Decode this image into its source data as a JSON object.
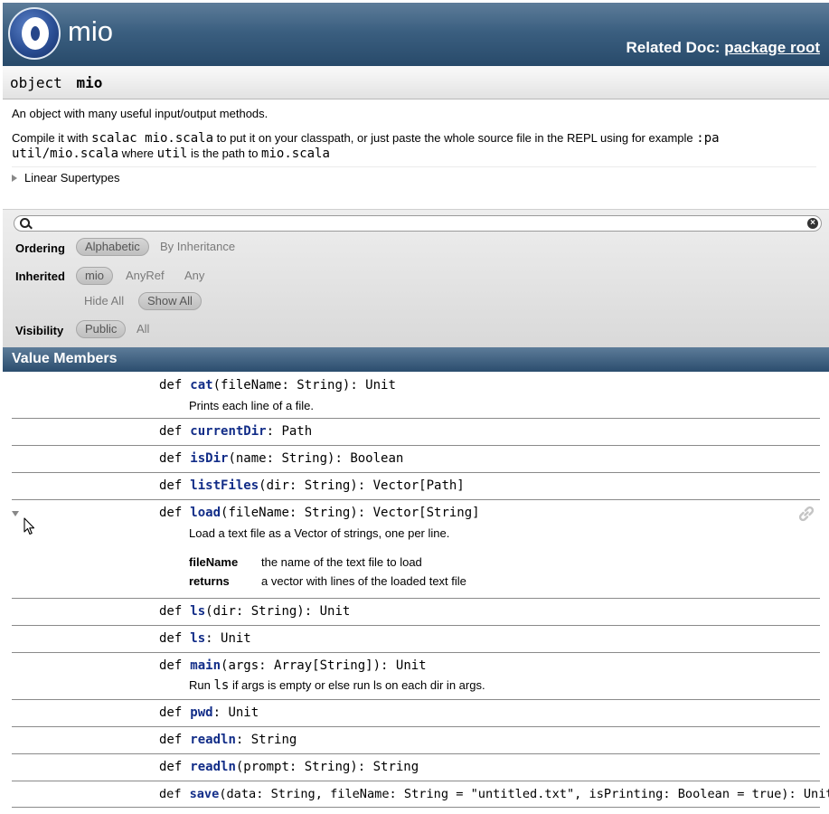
{
  "header": {
    "title": "mio",
    "related_label": "Related Doc:",
    "related_link": "package root"
  },
  "object": {
    "keyword": "object",
    "name": "mio"
  },
  "comment": {
    "line1": "An object with many useful input/output methods.",
    "line2_a": "Compile it with ",
    "line2_code1": "scalac mio.scala",
    "line2_b": " to put it on your classpath, or just paste the whole source file in the REPL using for example ",
    "line2_code2": ":pa",
    "line3_code1": "util/mio.scala",
    "line3_a": " where ",
    "line3_code2": "util",
    "line3_b": " is the path to ",
    "line3_code3": "mio.scala"
  },
  "supertypes_label": "Linear Supertypes",
  "filter": {
    "search_value": "",
    "ordering_label": "Ordering",
    "ordering_options": [
      "Alphabetic",
      "By Inheritance"
    ],
    "inherited_label": "Inherited",
    "inherited_options": [
      "mio",
      "AnyRef",
      "Any"
    ],
    "hide_all": "Hide All",
    "show_all": "Show All",
    "visibility_label": "Visibility",
    "visibility_options": [
      "Public",
      "All"
    ]
  },
  "value_members_title": "Value Members",
  "members": [
    {
      "kw": "def",
      "name": "cat",
      "params": "(fileName: String)",
      "ret": ": Unit",
      "desc": "Prints each line of a file."
    },
    {
      "kw": "def",
      "name": "currentDir",
      "params": "",
      "ret": ": Path"
    },
    {
      "kw": "def",
      "name": "isDir",
      "params": "(name: String)",
      "ret": ": Boolean"
    },
    {
      "kw": "def",
      "name": "listFiles",
      "params": "(dir: String)",
      "ret": ": Vector[Path]"
    },
    {
      "kw": "def",
      "name": "load",
      "params": "(fileName: String)",
      "ret": ": Vector[String]",
      "desc": "Load a text file as a Vector of strings, one per line.",
      "params_doc": [
        {
          "name": "fileName",
          "text": "the name of the text file to load"
        },
        {
          "name": "returns",
          "text": "a vector with lines of the loaded text file"
        }
      ]
    },
    {
      "kw": "def",
      "name": "ls",
      "params": "(dir: String)",
      "ret": ": Unit"
    },
    {
      "kw": "def",
      "name": "ls",
      "params": "",
      "ret": ": Unit"
    },
    {
      "kw": "def",
      "name": "main",
      "params": "(args: Array[String])",
      "ret": ": Unit",
      "desc_a": "Run ",
      "desc_code": "ls",
      "desc_b": " if args is empty or else run ls on each dir in args."
    },
    {
      "kw": "def",
      "name": "pwd",
      "params": "",
      "ret": ": Unit"
    },
    {
      "kw": "def",
      "name": "readln",
      "params": "",
      "ret": ": String"
    },
    {
      "kw": "def",
      "name": "readln",
      "params": "(prompt: String)",
      "ret": ": String"
    },
    {
      "kw": "def",
      "name": "save",
      "params": "(data: String, fileName: String = \"untitled.txt\", isPrinting: Boolean = true)",
      "ret": ": Unit"
    }
  ]
}
